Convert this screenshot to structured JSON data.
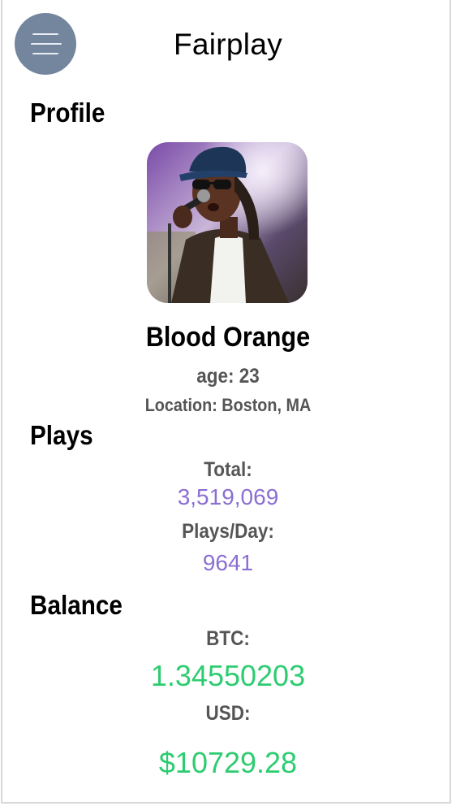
{
  "header": {
    "title": "Fairplay",
    "menu_icon": "hamburger-menu-icon"
  },
  "profile": {
    "section_title": "Profile",
    "name": "Blood Orange",
    "age": "age: 23",
    "location": "Location: Boston, MA"
  },
  "plays": {
    "section_title": "Plays",
    "total_label": "Total:",
    "total_value": "3,519,069",
    "per_day_label": "Plays/Day:",
    "per_day_value": "9641"
  },
  "balance": {
    "section_title": "Balance",
    "btc_label": "BTC:",
    "btc_value": "1.34550203",
    "usd_label": "USD:",
    "usd_value": "$10729.28"
  },
  "colors": {
    "menu_button": "#73869d",
    "plays_value": "#8b6fd1",
    "balance_value": "#2ecc71",
    "label_gray": "#555555"
  }
}
